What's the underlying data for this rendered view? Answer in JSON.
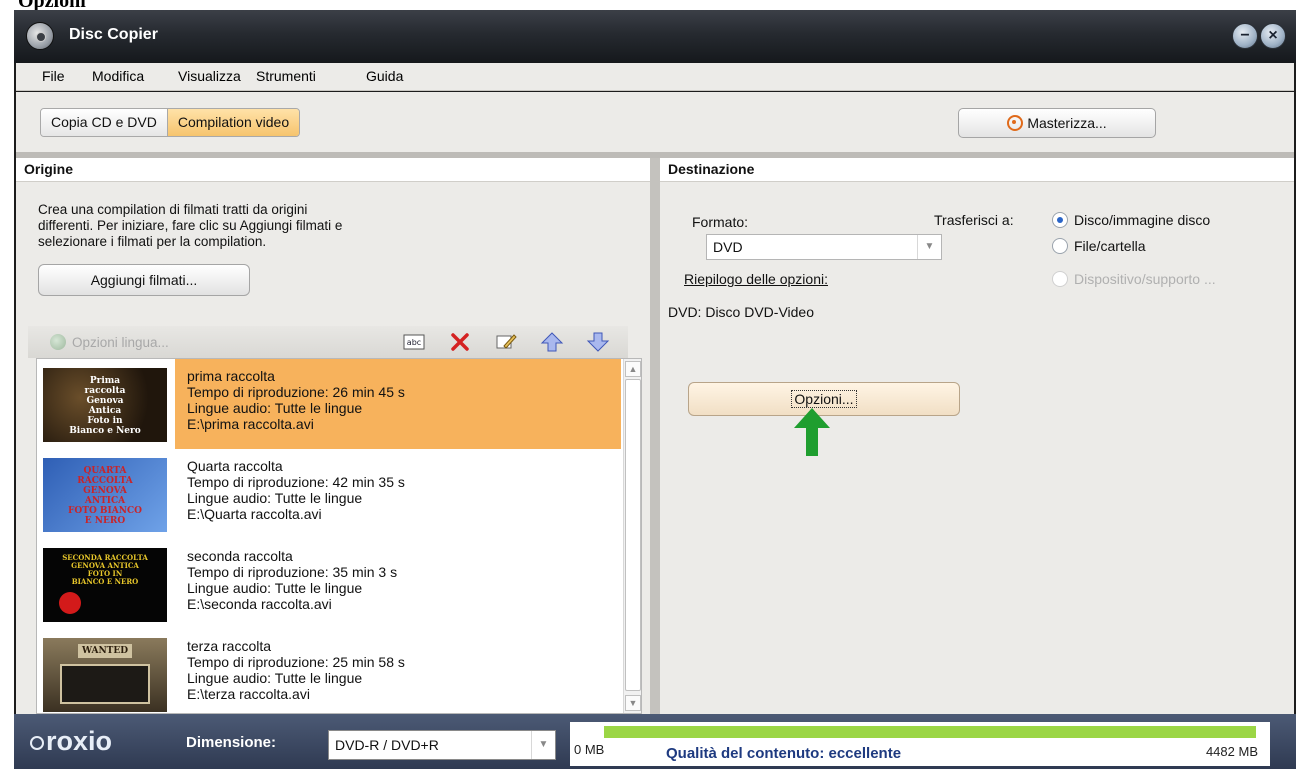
{
  "page": {
    "top_caption": "Opzioni"
  },
  "window": {
    "title": "Disc Copier",
    "minimize": "−",
    "close": "×"
  },
  "menu": [
    "File",
    "Modifica",
    "Visualizza",
    "Strumenti",
    "Guida"
  ],
  "toolbar": {
    "tabs": [
      {
        "label": "Copia CD e DVD",
        "active": false
      },
      {
        "label": "Compilation video",
        "active": true
      }
    ],
    "burn_label": "Masterizza..."
  },
  "origin": {
    "header": "Origine",
    "description": [
      "Crea una compilation di filmati tratti da origini",
      "differenti. Per iniziare, fare clic su Aggiungi filmati e",
      "selezionare i filmati per la compilation."
    ],
    "add_button": "Aggiungi filmati...",
    "lang_options": "Opzioni lingua...",
    "tools": [
      "rename-icon",
      "delete-icon",
      "edit-icon",
      "move-up-icon",
      "move-down-icon"
    ],
    "files": [
      {
        "name": "prima raccolta",
        "duration": "Tempo di riproduzione: 26 min 45 s",
        "languages": "Lingue audio: Tutte le lingue",
        "path": "E:\\prima raccolta.avi",
        "thumb_text": [
          "Prima",
          "raccolta",
          "Genova",
          "Antica",
          "Foto in",
          "Bianco e Nero"
        ],
        "selected": true
      },
      {
        "name": "Quarta raccolta",
        "duration": "Tempo di riproduzione: 42 min 35 s",
        "languages": "Lingue audio: Tutte le lingue",
        "path": "E:\\Quarta raccolta.avi",
        "thumb_text": [
          "QUARTA",
          "RACCOLTA",
          "GENOVA",
          "ANTICA",
          "FOTO BIANCO",
          "E NERO"
        ],
        "selected": false
      },
      {
        "name": "seconda raccolta",
        "duration": "Tempo di riproduzione: 35 min 3 s",
        "languages": "Lingue audio: Tutte le lingue",
        "path": "E:\\seconda raccolta.avi",
        "thumb_text": [
          "SECONDA RACCOLTA",
          "GENOVA ANTICA",
          "FOTO IN",
          "BIANCO E NERO"
        ],
        "selected": false
      },
      {
        "name": "terza raccolta",
        "duration": "Tempo di riproduzione: 25 min 58 s",
        "languages": "Lingue audio: Tutte le lingue",
        "path": "E:\\terza raccolta.avi",
        "thumb_text": [
          "WANTED"
        ],
        "selected": false
      }
    ]
  },
  "destination": {
    "header": "Destinazione",
    "format_label": "Formato:",
    "format_value": "DVD",
    "summary_link": "Riepilogo delle opzioni:",
    "summary_value": "DVD: Disco DVD-Video",
    "transfer_label": "Trasferisci a:",
    "transfer_options": [
      {
        "label": "Disco/immagine disco",
        "checked": true,
        "disabled": false
      },
      {
        "label": "File/cartella",
        "checked": false,
        "disabled": false
      },
      {
        "label": "Dispositivo/supporto ...",
        "checked": false,
        "disabled": true
      }
    ],
    "options_button": "Opzioni..."
  },
  "status": {
    "brand": "roxio",
    "size_label": "Dimensione:",
    "size_value": "DVD-R / DVD+R",
    "min_label": "0 MB",
    "max_label": "4482 MB",
    "quality": "Qualità del contenuto: eccellente",
    "fill_fraction": 1.0,
    "fill_color": "#9bd645"
  },
  "colors": {
    "selection": "#f7b25c",
    "active_tab": "#f6c46e",
    "status_bg": "#3a4763",
    "arrow": "#1f9e2f"
  }
}
